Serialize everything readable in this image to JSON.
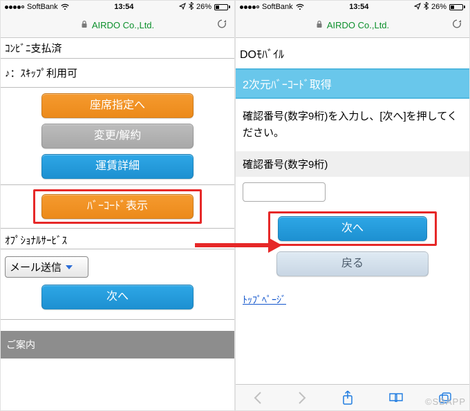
{
  "statusbar": {
    "carrier": "SoftBank",
    "time": "13:54",
    "battery_pct": "26%"
  },
  "urlbar": {
    "domain": "AIRDO Co.,Ltd."
  },
  "left": {
    "line1": "ｺﾝﾋﾞﾆ支払済",
    "line2": "♪：ｽｷｯﾌﾟ利用可",
    "btn_seat": "座席指定へ",
    "btn_change": "変更/解約",
    "btn_fare": "運賃詳細",
    "btn_barcode": "ﾊﾞｰｺｰﾄﾞ表示",
    "section_option": "ｵﾌﾟｼｮﾅﾙｻｰﾋﾞｽ",
    "select_mail": "メール送信",
    "btn_next": "次へ",
    "footer": "ご案内"
  },
  "right": {
    "page_title": "DOﾓﾊﾞｲﾙ",
    "section_head": "2次元ﾊﾞｰｺｰﾄﾞ取得",
    "instruction": "確認番号(数字9桁)を入力し、[次へ]を押してください。",
    "field_label": "確認番号(数字9桁)",
    "btn_next": "次へ",
    "btn_back": "戻る",
    "top_link": "ﾄｯﾌﾟﾍﾟｰｼﾞ"
  },
  "watermark": "©SBAPP"
}
